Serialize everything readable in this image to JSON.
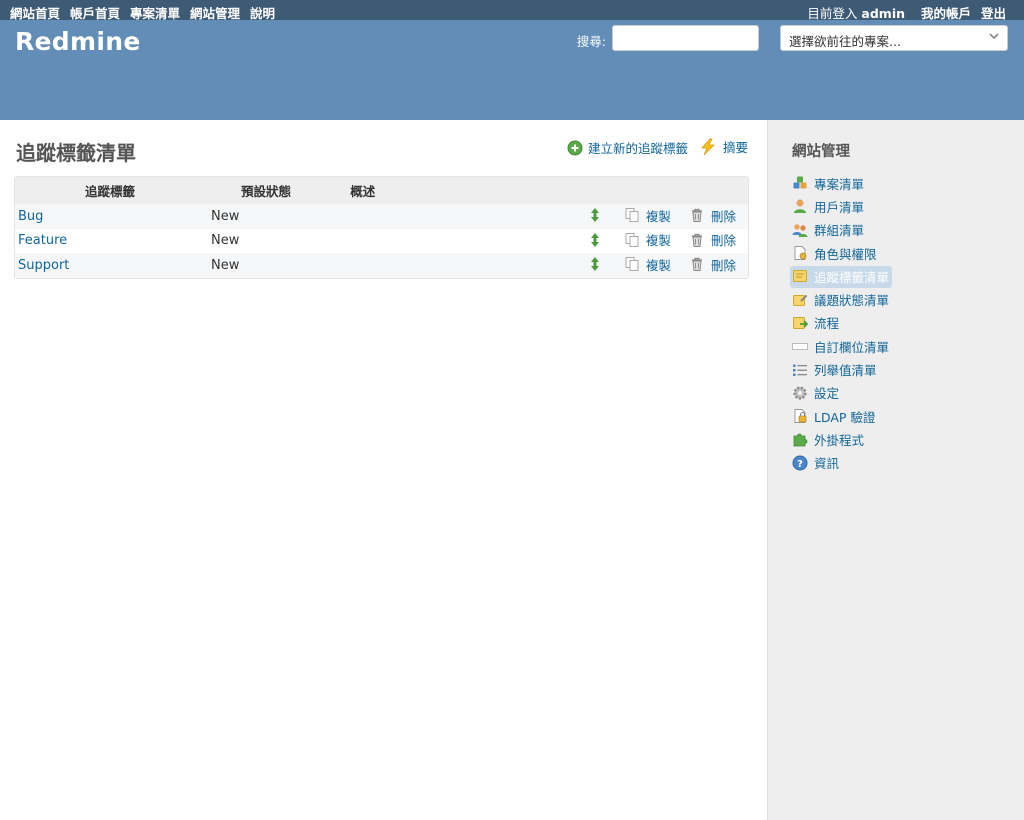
{
  "top_menu": {
    "left": [
      "網站首頁",
      "帳戶首頁",
      "專案清單",
      "網站管理",
      "說明"
    ],
    "logged_as_label": "目前登入",
    "user": "admin",
    "my_account": "我的帳戶",
    "logout": "登出"
  },
  "header": {
    "title": "Redmine",
    "search_label": "搜尋:",
    "search_value": "",
    "project_jump": "選擇欲前往的專案..."
  },
  "content": {
    "title": "追蹤標籤清單",
    "new_label": "建立新的追蹤標籤",
    "summary_label": "摘要",
    "columns": [
      "追蹤標籤",
      "預設狀態",
      "概述"
    ],
    "rows": [
      {
        "name": "Bug",
        "status": "New",
        "description": "",
        "copy": "複製",
        "delete": "刪除"
      },
      {
        "name": "Feature",
        "status": "New",
        "description": "",
        "copy": "複製",
        "delete": "刪除"
      },
      {
        "name": "Support",
        "status": "New",
        "description": "",
        "copy": "複製",
        "delete": "刪除"
      }
    ]
  },
  "sidebar": {
    "title": "網站管理",
    "items": [
      {
        "label": "專案清單",
        "icon": "projects-icon"
      },
      {
        "label": "用戶清單",
        "icon": "user-icon"
      },
      {
        "label": "群組清單",
        "icon": "group-icon"
      },
      {
        "label": "角色與權限",
        "icon": "roles-icon"
      },
      {
        "label": "追蹤標籤清單",
        "icon": "tracker-icon",
        "selected": true
      },
      {
        "label": "議題狀態清單",
        "icon": "issue-status-icon"
      },
      {
        "label": "流程",
        "icon": "workflow-icon"
      },
      {
        "label": "自訂欄位清單",
        "icon": "custom-field-icon"
      },
      {
        "label": "列舉值清單",
        "icon": "list-icon"
      },
      {
        "label": "設定",
        "icon": "gear-icon"
      },
      {
        "label": "LDAP 驗證",
        "icon": "ldap-icon"
      },
      {
        "label": "外掛程式",
        "icon": "plugin-icon"
      },
      {
        "label": "資訊",
        "icon": "help-icon"
      }
    ]
  },
  "colors": {
    "top_menu_bg": "#3e5b76",
    "header_bg": "#628db6",
    "link": "#169",
    "sidebar_bg": "#eee",
    "selected_bg": "#c8d9ea"
  }
}
